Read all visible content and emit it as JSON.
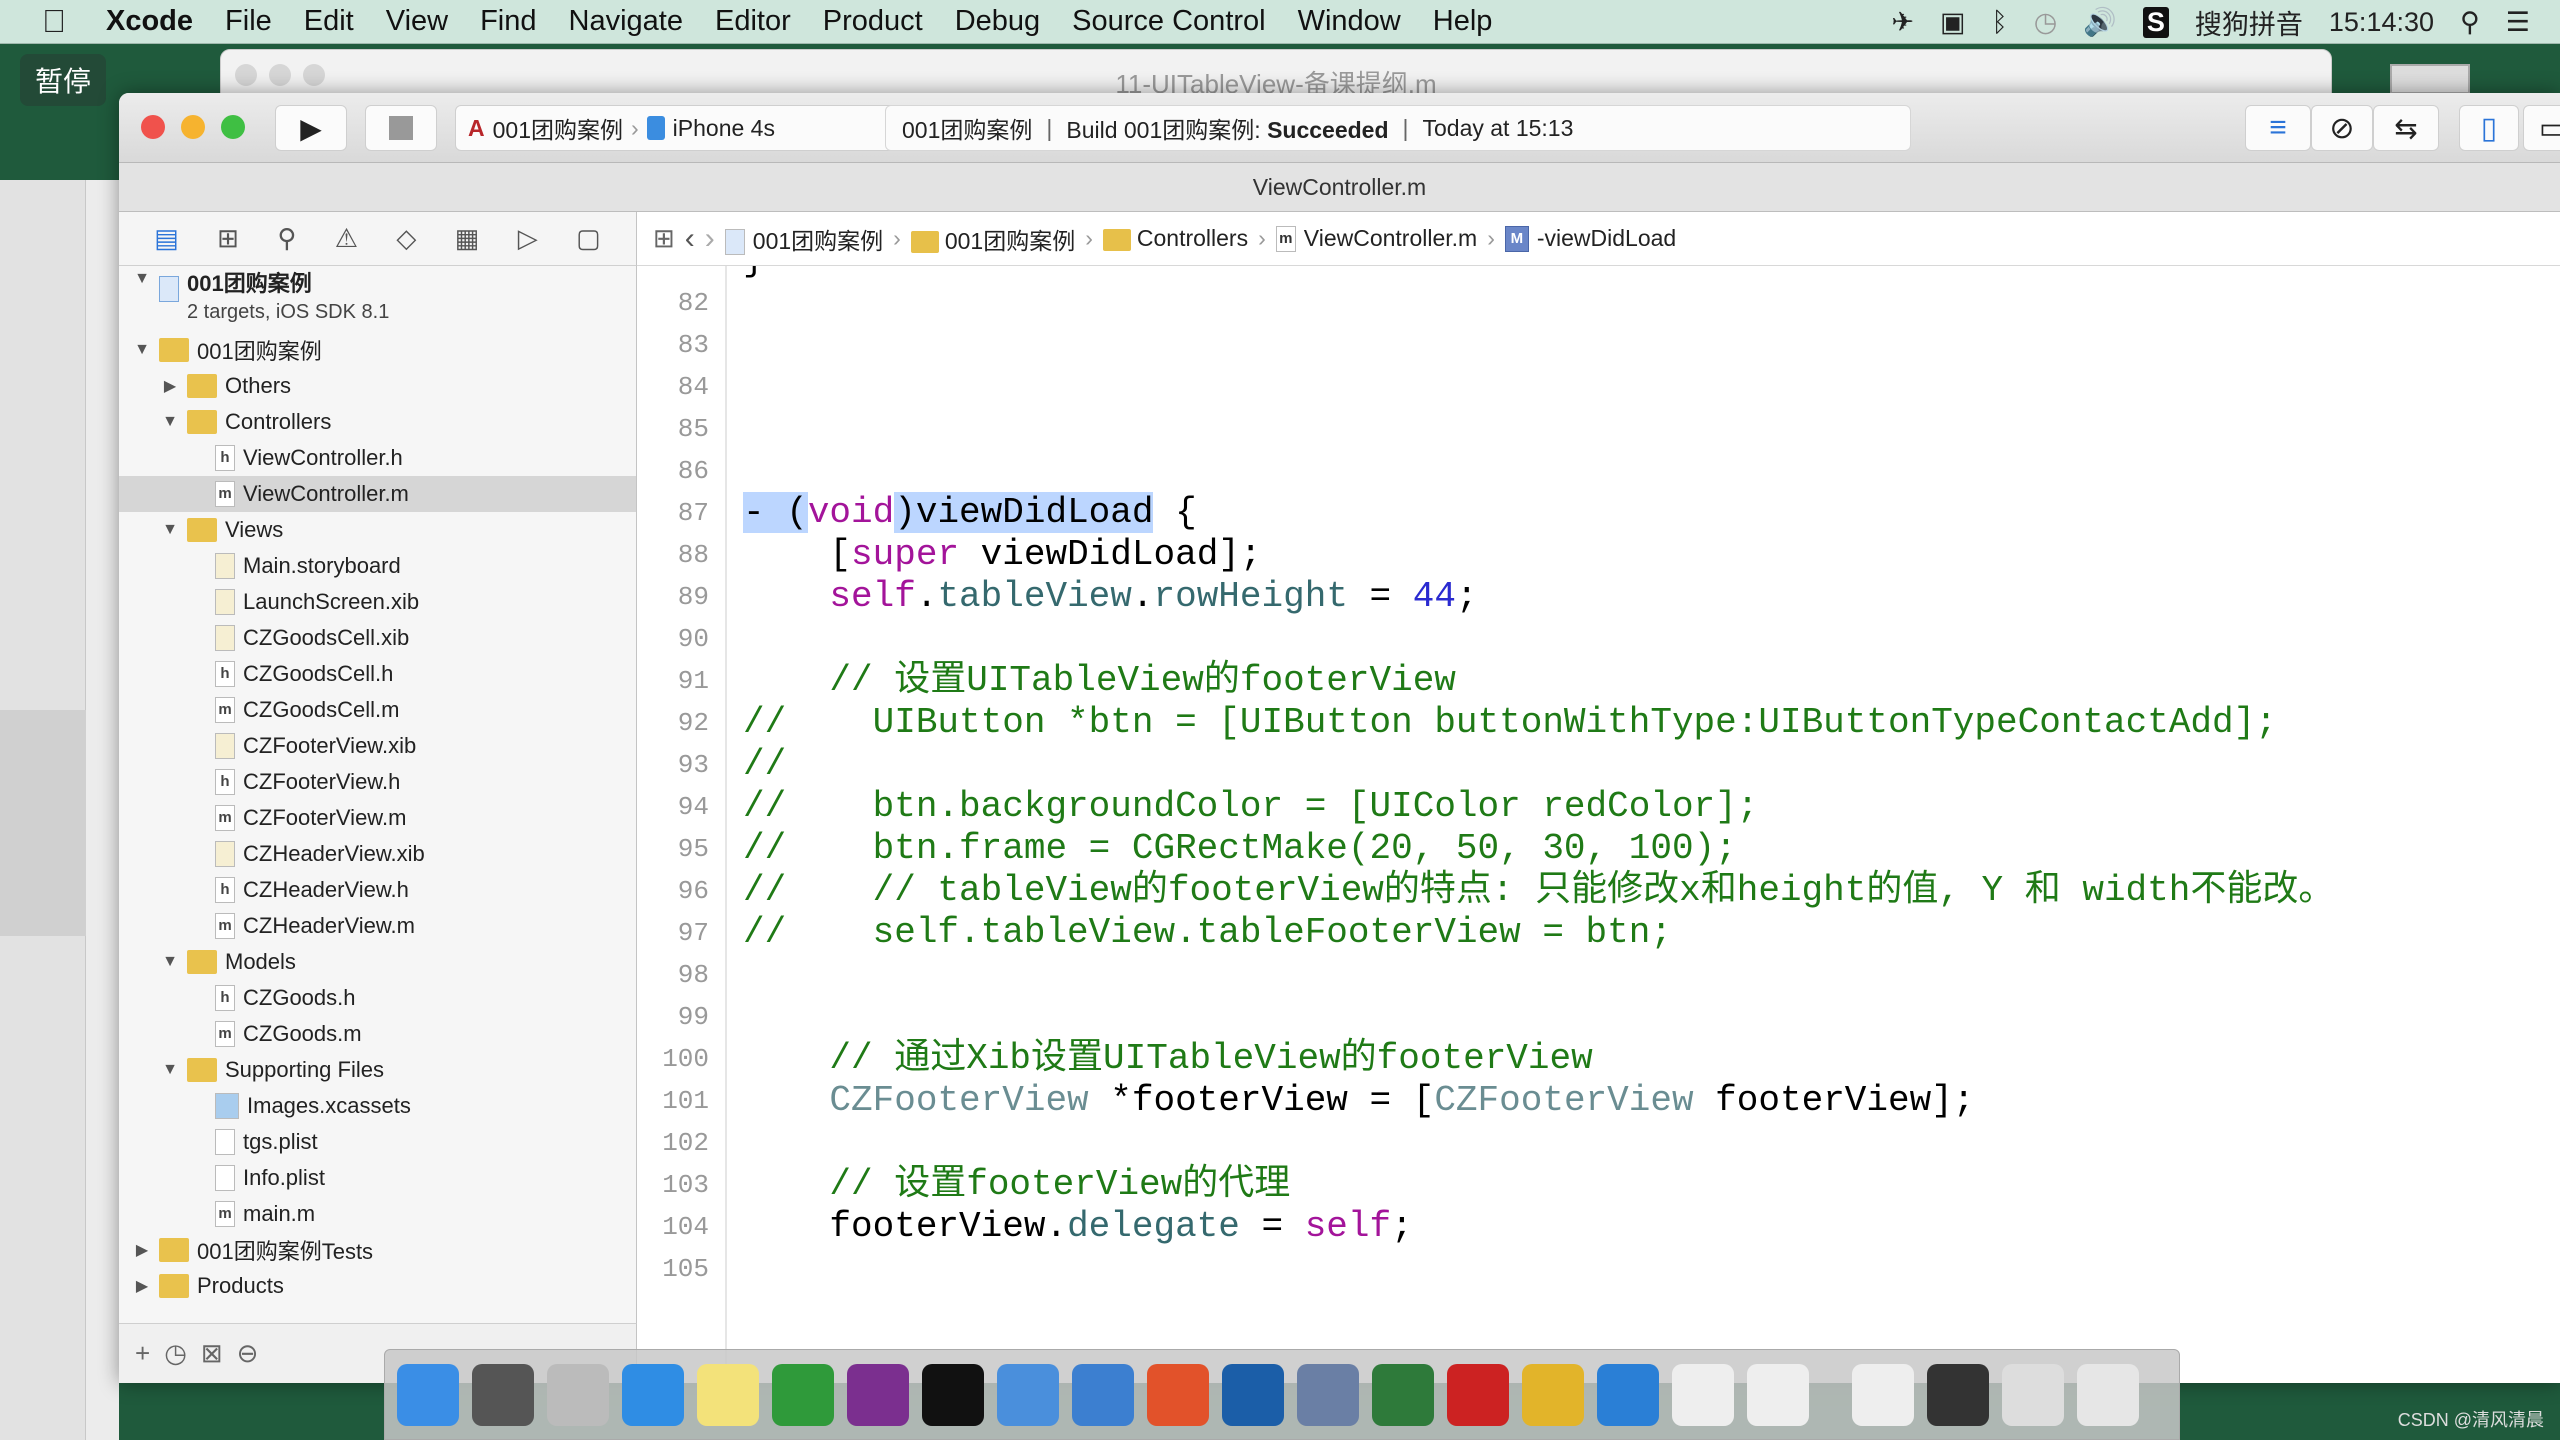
{
  "menubar": {
    "app": "Xcode",
    "items": [
      "File",
      "Edit",
      "View",
      "Find",
      "Navigate",
      "Editor",
      "Product",
      "Debug",
      "Source Control",
      "Window",
      "Help"
    ],
    "input_method": "搜狗拼音",
    "clock": "15:14:30"
  },
  "overlay": {
    "pause_label": "暂停",
    "watermark": "CSDN @清风清晨"
  },
  "back_window": {
    "title": "11-UITableView-备课提纲.m"
  },
  "toolbar": {
    "scheme": "001团购案例",
    "device": "iPhone 4s",
    "activity": {
      "project": "001团购案例",
      "build_prefix": "Build 001团购案例:",
      "status": "Succeeded",
      "time": "Today at 15:13"
    }
  },
  "tab": {
    "title": "ViewController.m"
  },
  "jumpbar": {
    "items": [
      "001团购案例",
      "001团购案例",
      "Controllers",
      "ViewController.m",
      "-viewDidLoad"
    ]
  },
  "navigator": {
    "project": {
      "name": "001团购案例",
      "subtitle": "2 targets, iOS SDK 8.1"
    },
    "items": [
      {
        "label": "001团购案例",
        "level": 1,
        "type": "folder",
        "open": true
      },
      {
        "label": "Others",
        "level": 2,
        "type": "folder",
        "open": false
      },
      {
        "label": "Controllers",
        "level": 2,
        "type": "folder",
        "open": true
      },
      {
        "label": "ViewController.h",
        "level": 3,
        "type": "h"
      },
      {
        "label": "ViewController.m",
        "level": 3,
        "type": "m",
        "selected": true
      },
      {
        "label": "Views",
        "level": 2,
        "type": "folder",
        "open": true
      },
      {
        "label": "Main.storyboard",
        "level": 3,
        "type": "sb"
      },
      {
        "label": "LaunchScreen.xib",
        "level": 3,
        "type": "xib"
      },
      {
        "label": "CZGoodsCell.xib",
        "level": 3,
        "type": "xib"
      },
      {
        "label": "CZGoodsCell.h",
        "level": 3,
        "type": "h"
      },
      {
        "label": "CZGoodsCell.m",
        "level": 3,
        "type": "m"
      },
      {
        "label": "CZFooterView.xib",
        "level": 3,
        "type": "xib"
      },
      {
        "label": "CZFooterView.h",
        "level": 3,
        "type": "h"
      },
      {
        "label": "CZFooterView.m",
        "level": 3,
        "type": "m"
      },
      {
        "label": "CZHeaderView.xib",
        "level": 3,
        "type": "xib"
      },
      {
        "label": "CZHeaderView.h",
        "level": 3,
        "type": "h"
      },
      {
        "label": "CZHeaderView.m",
        "level": 3,
        "type": "m"
      },
      {
        "label": "Models",
        "level": 2,
        "type": "folder",
        "open": true
      },
      {
        "label": "CZGoods.h",
        "level": 3,
        "type": "h"
      },
      {
        "label": "CZGoods.m",
        "level": 3,
        "type": "m"
      },
      {
        "label": "Supporting Files",
        "level": 2,
        "type": "folder",
        "open": true
      },
      {
        "label": "Images.xcassets",
        "level": 3,
        "type": "assets"
      },
      {
        "label": "tgs.plist",
        "level": 3,
        "type": "plist"
      },
      {
        "label": "Info.plist",
        "level": 3,
        "type": "plist"
      },
      {
        "label": "main.m",
        "level": 3,
        "type": "m"
      },
      {
        "label": "001团购案例Tests",
        "level": 1,
        "type": "folder",
        "open": false
      },
      {
        "label": "Products",
        "level": 1,
        "type": "folder",
        "open": false
      }
    ]
  },
  "editor": {
    "first_line": 82,
    "lines": [
      [],
      [],
      [],
      [],
      [],
      [
        [
          "- (",
          "s"
        ],
        [
          "void",
          "k"
        ],
        [
          ")viewDidLoad",
          "s"
        ],
        [
          " {",
          "p"
        ]
      ],
      [
        [
          "    [",
          "p"
        ],
        [
          "super",
          "k"
        ],
        [
          " viewDidLoad];",
          "p"
        ]
      ],
      [
        [
          "    ",
          "p"
        ],
        [
          "self",
          "k"
        ],
        [
          ".",
          "p"
        ],
        [
          "tableView",
          "f"
        ],
        [
          ".",
          "p"
        ],
        [
          "rowHeight",
          "f"
        ],
        [
          " = ",
          "p"
        ],
        [
          "44",
          "n"
        ],
        [
          ";",
          "p"
        ]
      ],
      [],
      [
        [
          "    // 设置UITableView的footerView",
          "c"
        ]
      ],
      [
        [
          "//    UIButton *btn = [UIButton buttonWithType:UIButtonTypeContactAdd];",
          "c"
        ]
      ],
      [
        [
          "//",
          "c"
        ]
      ],
      [
        [
          "//    btn.backgroundColor = [UIColor redColor];",
          "c"
        ]
      ],
      [
        [
          "//    btn.frame = CGRectMake(20, 50, 30, 100);",
          "c"
        ]
      ],
      [
        [
          "//    // tableView的footerView的特点: 只能修改x和height的值, Y 和 width不能改。",
          "c"
        ]
      ],
      [
        [
          "//    self.tableView.tableFooterView = btn;",
          "c"
        ]
      ],
      [],
      [],
      [
        [
          "    // 通过Xib设置UITableView的footerView",
          "c"
        ]
      ],
      [
        [
          "    ",
          "p"
        ],
        [
          "CZFooterView",
          "cls"
        ],
        [
          " *footerView = [",
          "p"
        ],
        [
          "CZFooterView",
          "cls"
        ],
        [
          " footerView];",
          "p"
        ]
      ],
      [],
      [
        [
          "    // 设置footerView的代理",
          "c"
        ]
      ],
      [
        [
          "    footerView.",
          "p"
        ],
        [
          "delegate",
          "f"
        ],
        [
          " = ",
          "p"
        ],
        [
          "self",
          "k"
        ],
        [
          ";",
          "p"
        ]
      ],
      []
    ]
  },
  "dock": {
    "apps": [
      "finder",
      "system-preferences",
      "launchpad",
      "safari",
      "notes",
      "excel",
      "onenote",
      "terminal",
      "xcode",
      "simulator",
      "powerpoint",
      "screenshot",
      "video",
      "network-utility",
      "filezilla",
      "pages-tools",
      "word",
      "textedit",
      "textedit-2",
      "preview-doc",
      "screen-share",
      "downloads",
      "trash"
    ],
    "colors": [
      "#3a8ee6",
      "#555",
      "#bbb",
      "#2f8de4",
      "#f3e27a",
      "#2f9a3a",
      "#7b2f8f",
      "#111",
      "#4a8fdc",
      "#3c7fd0",
      "#e2522a",
      "#1b5ea8",
      "#6a7fa5",
      "#2e7a3a",
      "#c22",
      "#e2b42a",
      "#2a7fd6",
      "#eee",
      "#eee",
      "#eee",
      "#333",
      "#ddd",
      "#e6e6e6"
    ]
  }
}
